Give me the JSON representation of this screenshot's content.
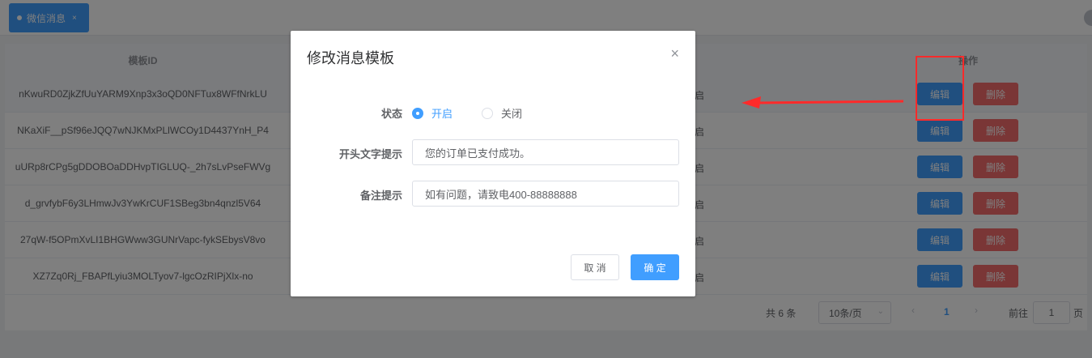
{
  "tabs": [
    {
      "label": "微信消息",
      "close": "×"
    }
  ],
  "table": {
    "headers": {
      "id": "模板ID",
      "status": "态",
      "operation": "操作"
    },
    "rows": [
      {
        "id": "nKwuRD0ZjkZfUuYARM9Xnp3x3oQD0NFTux8WFfNrkLU",
        "status": "启"
      },
      {
        "id": "NKaXiF__pSf96eJQQ7wNJKMxPLlWCOy1D4437YnH_P4",
        "status": "启"
      },
      {
        "id": "uURp8rCPg5gDDOBOaDDHvpTIGLUQ-_2h7sLvPseFWVg",
        "status": "启"
      },
      {
        "id": "d_grvfybF6y3LHmwJv3YwKrCUF1SBeg3bn4qnzl5V64",
        "status": "启"
      },
      {
        "id": "27qW-f5OPmXvLI1BHGWww3GUNrVapc-fykSEbysV8vo",
        "status": "启"
      },
      {
        "id": "XZ7Zq0Rj_FBAPfLyiu3MOLTyov7-lgcOzRIPjXlx-no",
        "status": "启"
      }
    ],
    "edit_label": "编辑",
    "delete_label": "删除"
  },
  "pagination": {
    "total": "共 6 条",
    "page_size": "10条/页",
    "current_page": "1",
    "goto_label": "前往",
    "goto_value": "1",
    "page_unit": "页"
  },
  "modal": {
    "title": "修改消息模板",
    "fields": {
      "status_label": "状态",
      "status_on": "开启",
      "status_off": "关闭",
      "status_selected": "开启",
      "header_label": "开头文字提示",
      "header_value": "您的订单已支付成功。",
      "remark_label": "备注提示",
      "remark_value": "如有问题，请致电400-88888888"
    },
    "cancel_label": "取 消",
    "confirm_label": "确 定"
  },
  "colors": {
    "primary": "#409eff",
    "danger": "#f56c6c",
    "annotation": "#ff2a2a"
  }
}
